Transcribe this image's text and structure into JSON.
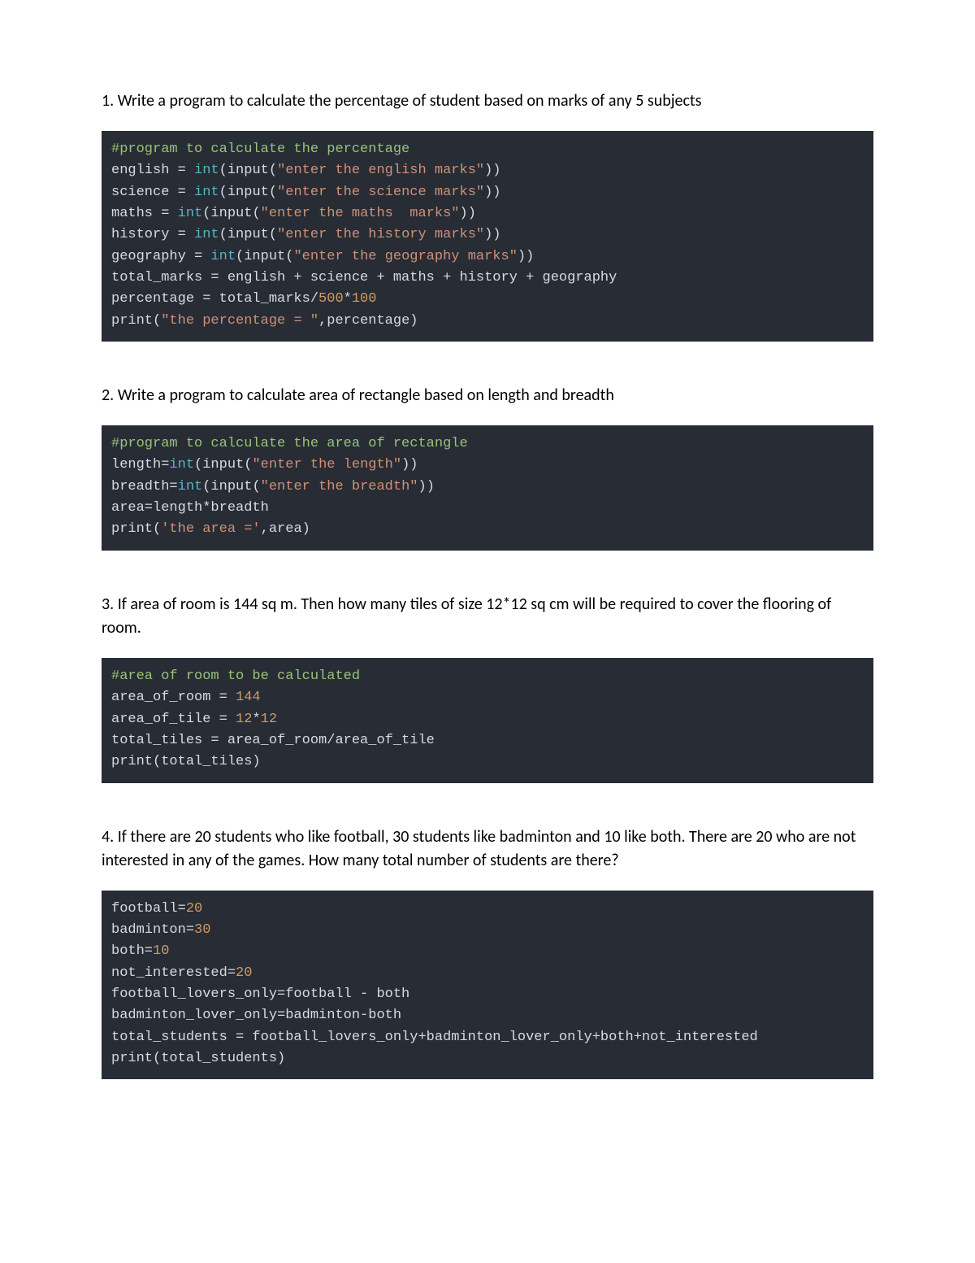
{
  "items": [
    {
      "question": "1. Write a program to calculate the percentage of student based on marks of any 5 subjects",
      "code": {
        "lines": [
          [
            {
              "c": "tok-cm",
              "t": "#program to calculate the percentage"
            }
          ],
          [
            {
              "t": "english = "
            },
            {
              "c": "tok-bi",
              "t": "int"
            },
            {
              "t": "(input("
            },
            {
              "c": "tok-str",
              "t": "\"enter the english marks\""
            },
            {
              "t": "))"
            }
          ],
          [
            {
              "t": "science = "
            },
            {
              "c": "tok-bi",
              "t": "int"
            },
            {
              "t": "(input("
            },
            {
              "c": "tok-str",
              "t": "\"enter the science marks\""
            },
            {
              "t": "))"
            }
          ],
          [
            {
              "t": "maths = "
            },
            {
              "c": "tok-bi",
              "t": "int"
            },
            {
              "t": "(input("
            },
            {
              "c": "tok-str",
              "t": "\"enter the maths  marks\""
            },
            {
              "t": "))"
            }
          ],
          [
            {
              "t": "history = "
            },
            {
              "c": "tok-bi",
              "t": "int"
            },
            {
              "t": "(input("
            },
            {
              "c": "tok-str",
              "t": "\"enter the history marks\""
            },
            {
              "t": "))"
            }
          ],
          [
            {
              "t": "geography = "
            },
            {
              "c": "tok-bi",
              "t": "int"
            },
            {
              "t": "(input("
            },
            {
              "c": "tok-str",
              "t": "\"enter the geography marks\""
            },
            {
              "t": "))"
            }
          ],
          [
            {
              "t": "total_marks = english + science + maths + history + geography"
            }
          ],
          [
            {
              "t": "percentage = total_marks/"
            },
            {
              "c": "tok-num",
              "t": "500"
            },
            {
              "t": "*"
            },
            {
              "c": "tok-num",
              "t": "100"
            }
          ],
          [
            {
              "t": "print("
            },
            {
              "c": "tok-str",
              "t": "\"the percentage = \""
            },
            {
              "t": ",percentage)"
            }
          ]
        ]
      }
    },
    {
      "question": "2. Write a program to calculate area of rectangle based on length and breadth",
      "code": {
        "lines": [
          [
            {
              "c": "tok-cm",
              "t": "#program to calculate the area of rectangle"
            }
          ],
          [
            {
              "t": "length="
            },
            {
              "c": "tok-bi",
              "t": "int"
            },
            {
              "t": "(input("
            },
            {
              "c": "tok-str",
              "t": "\"enter the length\""
            },
            {
              "t": "))"
            }
          ],
          [
            {
              "t": "breadth="
            },
            {
              "c": "tok-bi",
              "t": "int"
            },
            {
              "t": "(input("
            },
            {
              "c": "tok-str",
              "t": "\"enter the breadth\""
            },
            {
              "t": "))"
            }
          ],
          [
            {
              "t": "area=length*breadth"
            }
          ],
          [
            {
              "t": "print("
            },
            {
              "c": "tok-str",
              "t": "'the area ='"
            },
            {
              "t": ",area)"
            }
          ]
        ]
      }
    },
    {
      "question": "3. If area of room is 144 sq m. Then how many tiles of size 12*12 sq cm will be required to cover the flooring of room.",
      "code": {
        "lines": [
          [
            {
              "c": "tok-cm",
              "t": "#area of room to be calculated"
            }
          ],
          [
            {
              "t": "area_of_room = "
            },
            {
              "c": "tok-num",
              "t": "144"
            }
          ],
          [
            {
              "t": "area_of_tile = "
            },
            {
              "c": "tok-num",
              "t": "12"
            },
            {
              "t": "*"
            },
            {
              "c": "tok-num",
              "t": "12"
            }
          ],
          [
            {
              "t": "total_tiles = area_of_room/area_of_tile"
            }
          ],
          [
            {
              "t": "print(total_tiles)"
            }
          ]
        ]
      }
    },
    {
      "question": "4. If there are 20 students who like football, 30 students like badminton and 10 like both. There are 20 who are not interested in any of the games. How many total number of students are there?",
      "code": {
        "lines": [
          [
            {
              "t": "football="
            },
            {
              "c": "tok-num",
              "t": "20"
            }
          ],
          [
            {
              "t": "badminton="
            },
            {
              "c": "tok-num",
              "t": "30"
            }
          ],
          [
            {
              "t": "both="
            },
            {
              "c": "tok-num",
              "t": "10"
            }
          ],
          [
            {
              "t": "not_interested="
            },
            {
              "c": "tok-num",
              "t": "20"
            }
          ],
          [
            {
              "t": "football_lovers_only=football - both"
            }
          ],
          [
            {
              "t": "badminton_lover_only=badminton-both"
            }
          ],
          [
            {
              "t": "total_students = football_lovers_only+badminton_lover_only+both+not_interested"
            }
          ],
          [
            {
              "t": "print(total_students)"
            }
          ]
        ]
      }
    }
  ]
}
